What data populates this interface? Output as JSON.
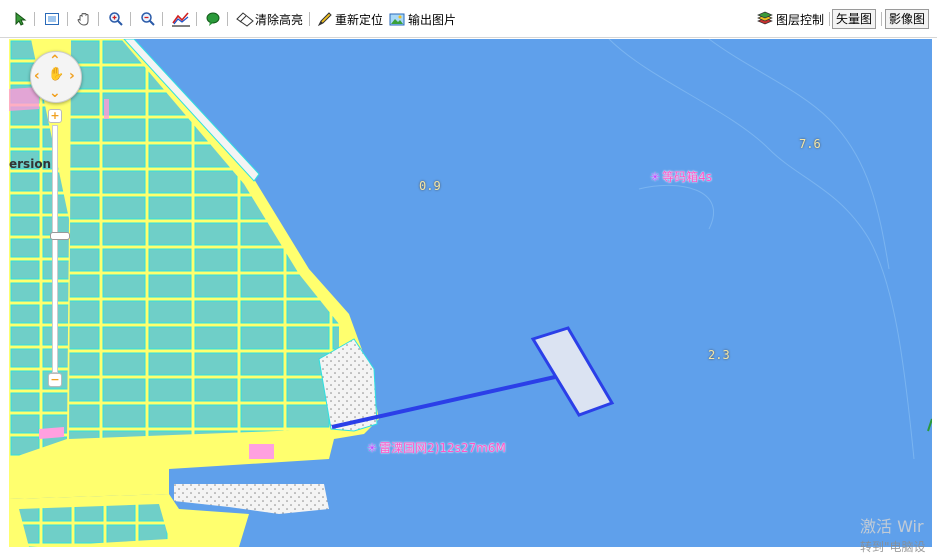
{
  "toolbar": {
    "clear_highlight": "清除高亮",
    "relocate": "重新定位",
    "export_image": "输出图片",
    "layer_control": "图层控制",
    "vector_map": "矢量图",
    "image_map": "影像图"
  },
  "map": {
    "version_text": "ersion.",
    "depth_labels": [
      "0.9",
      "7.6",
      "2.3"
    ],
    "poi_1": "等码箱4s",
    "poi_2": "雷溧国网2)12s27m6M",
    "zoom_level_fraction": 0.44,
    "colors": {
      "sea": "#5fa0eb",
      "land": "#ffff6e",
      "block": "#6fcfc8",
      "block_line": "#2fe0e0",
      "pier": "#2b3fe8",
      "platform": "#dbe3f2"
    }
  },
  "watermark": {
    "line1": "激活 Wir",
    "line2": "转到\"电脑设"
  },
  "icons": [
    "select-icon",
    "full-extent-icon",
    "pan-icon",
    "zoom-in-icon",
    "zoom-out-icon",
    "measure-icon",
    "tag-icon",
    "eraser-icon",
    "pen-icon",
    "picture-icon",
    "layers-icon"
  ]
}
